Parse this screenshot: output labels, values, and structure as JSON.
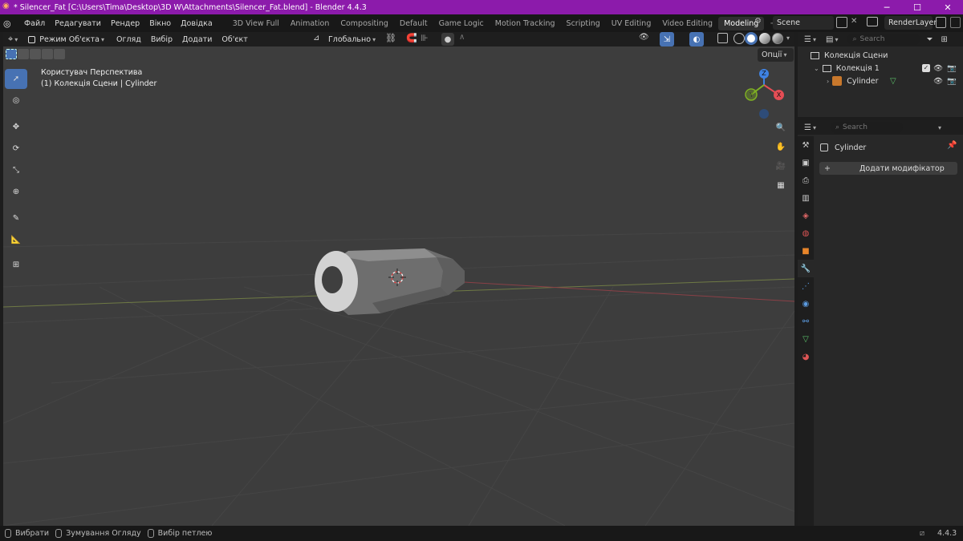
{
  "window": {
    "title": "* Silencer_Fat [C:\\Users\\Tima\\Desktop\\3D W\\Attachments\\Silencer_Fat.blend] - Blender 4.4.3",
    "minimize": "─",
    "maximize": "☐",
    "close": "✕"
  },
  "menu": [
    "Файл",
    "Редагувати",
    "Рендер",
    "Вікно",
    "Довідка"
  ],
  "workspaces": [
    "3D View Full",
    "Animation",
    "Compositing",
    "Default",
    "Game Logic",
    "Motion Tracking",
    "Scripting",
    "UV Editing",
    "Video Editing",
    "Modeling"
  ],
  "active_workspace": "Modeling",
  "add_workspace": "+",
  "scene": {
    "label": "Scene",
    "render_layer": "RenderLayer"
  },
  "viewport_header": {
    "mode": "Режим Об'єкта",
    "menus": [
      "Огляд",
      "Вибір",
      "Додати",
      "Об'єкт"
    ],
    "transform_orientation": "Глобально",
    "options": "Опції"
  },
  "viewport": {
    "view_name": "Користувач Перспектива",
    "collection_info": "(1) Колекція Сцени | Cylinder",
    "gizmo": {
      "x": "X",
      "y": "Y",
      "z": "Z"
    }
  },
  "outliner": {
    "search_placeholder": "Search",
    "scene_collection": "Колекція Сцени",
    "collection": "Колекція 1",
    "object": "Cylinder"
  },
  "properties": {
    "search_placeholder": "Search",
    "object_name": "Cylinder",
    "add_modifier": "Додати модифікатор"
  },
  "statusbar": {
    "select": "Вибрати",
    "zoom": "Зумування Огляду",
    "loop_select": "Вибір петлею",
    "version": "4.4.3"
  },
  "colors": {
    "titlebar": "#8c1bab",
    "accent": "#4772b3",
    "axis_x": "#e54d55",
    "axis_y": "#80b223",
    "axis_z": "#3f82e2"
  }
}
